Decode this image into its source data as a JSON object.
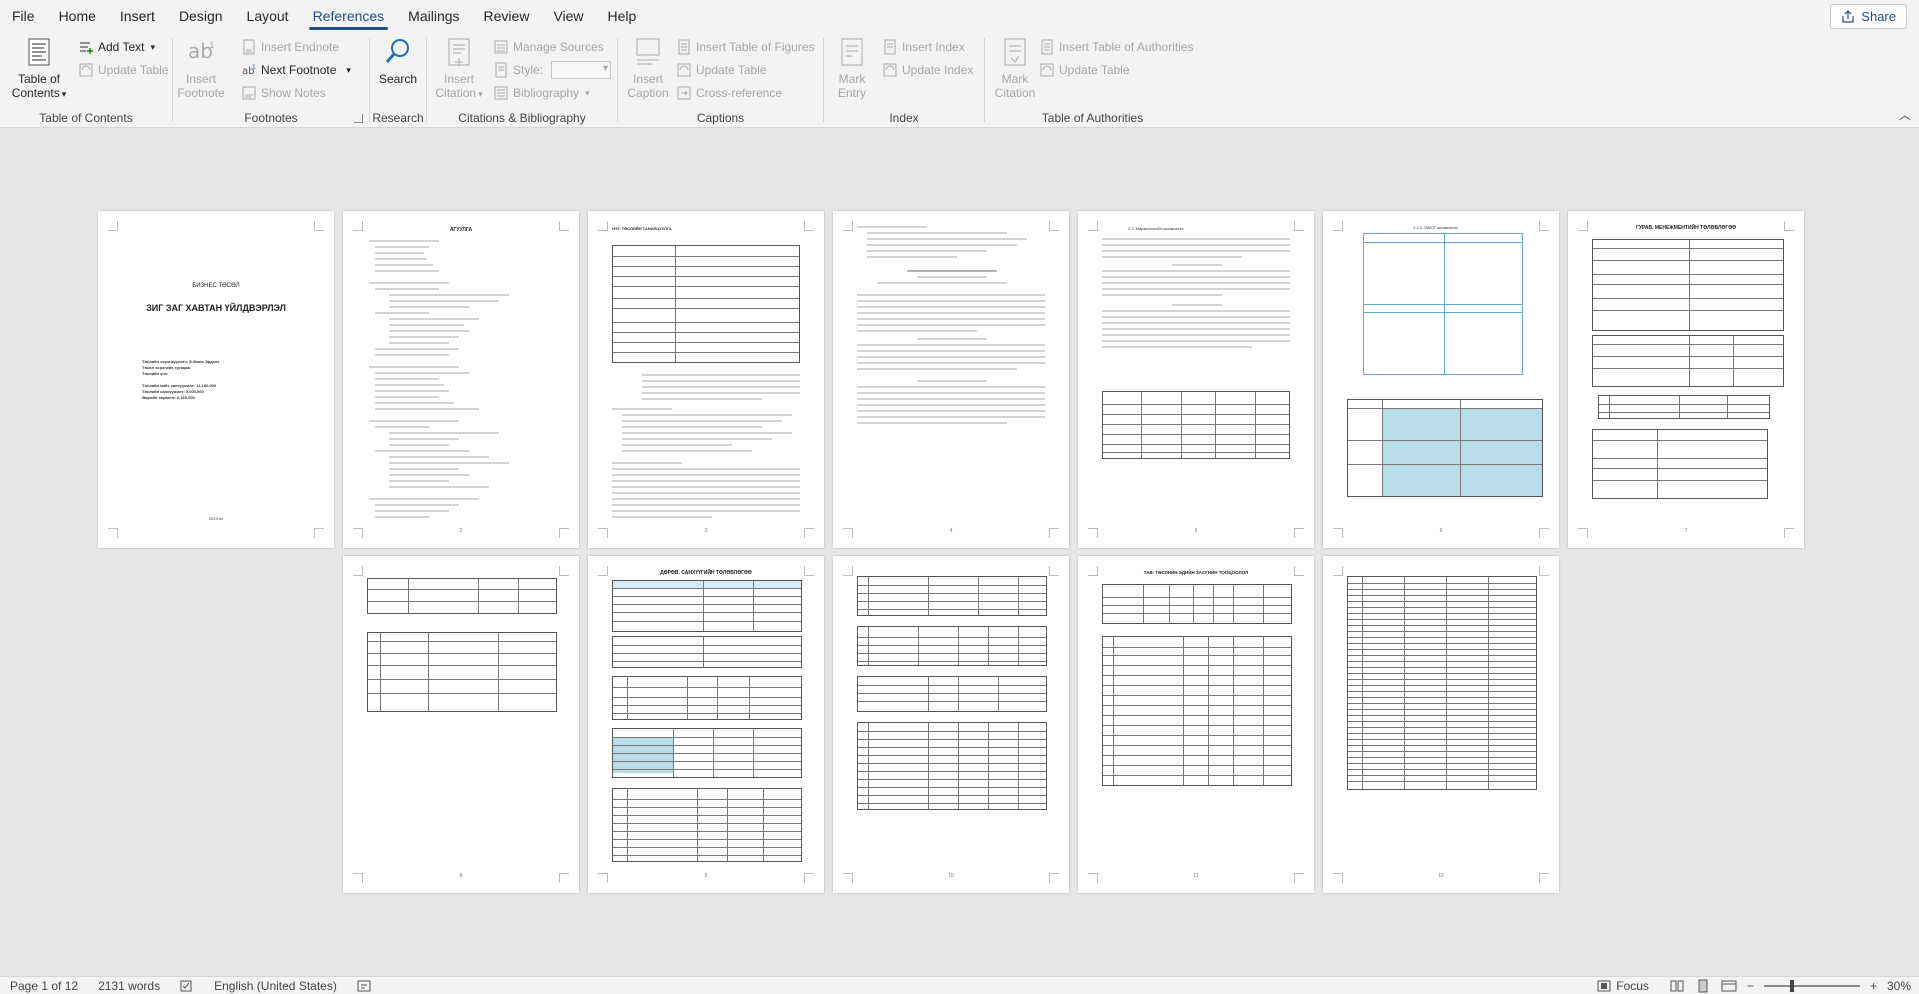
{
  "menu": {
    "tabs": [
      "File",
      "Home",
      "Insert",
      "Design",
      "Layout",
      "References",
      "Mailings",
      "Review",
      "View",
      "Help"
    ],
    "active": "References",
    "share_label": "Share"
  },
  "ribbon": {
    "toc": {
      "btn_line1": "Table of",
      "btn_line2": "Contents",
      "add_text": "Add Text",
      "update_table": "Update Table",
      "label": "Table of Contents"
    },
    "footnotes": {
      "insert_footnote_l1": "Insert",
      "insert_footnote_l2": "Footnote",
      "insert_endnote": "Insert Endnote",
      "next_footnote": "Next Footnote",
      "show_notes": "Show Notes",
      "label": "Footnotes"
    },
    "research": {
      "search": "Search",
      "label": "Research"
    },
    "citations": {
      "insert_citation_l1": "Insert",
      "insert_citation_l2": "Citation",
      "manage_sources": "Manage Sources",
      "style": "Style:",
      "bibliography": "Bibliography",
      "label": "Citations & Bibliography"
    },
    "captions": {
      "insert_caption_l1": "Insert",
      "insert_caption_l2": "Caption",
      "insert_tof": "Insert Table of Figures",
      "update_table": "Update Table",
      "cross_reference": "Cross-reference",
      "label": "Captions"
    },
    "index": {
      "mark_entry_l1": "Mark",
      "mark_entry_l2": "Entry",
      "insert_index": "Insert Index",
      "update_index": "Update Index",
      "label": "Index"
    },
    "toa": {
      "mark_citation_l1": "Mark",
      "mark_citation_l2": "Citation",
      "insert_toa": "Insert Table of Authorities",
      "update_table": "Update Table",
      "label": "Table of Authorities"
    }
  },
  "pages": {
    "p1": {
      "title1": "БИЗНЕС ТӨСӨЛ",
      "title2": "ЗИГ ЗАГ ХАВТАН ҮЙЛДВЭРЛЭЛ",
      "l1": "Төслийн хэрэгжүүлэгч: Б.Мөнх-Эрдэнэ",
      "l2": "Төсөл хэрэгжих хугацаа:",
      "l3": "Төслийн үнэ:",
      "l4": "Төслийн нийт санхүүжилт: 11,160,000",
      "l5": "Төслийн санхүүжилт: 5,000,000",
      "l6": "Өөрийн хөрөнгө: 6,160,000",
      "footer": "2023 он"
    },
    "p2": {
      "title": "АГУУЛГА"
    },
    "p3": {
      "title": "НЭГ. ТӨСЛИЙН ТАНИЛЦУУЛГА"
    },
    "p5": {
      "title": "2.2. Маркетингийн шинжилгээ"
    },
    "p6": {
      "title": "2.2.3. SWOT шинжилгээ"
    },
    "p7": {
      "title": "ГУРАВ. МЕНЕЖМЕНТИЙН ТӨЛӨВЛӨГӨӨ"
    },
    "p9": {
      "title": "ДӨРӨВ. САНХҮҮГИЙН ТӨЛӨВЛӨГӨӨ"
    },
    "p11": {
      "title": "ТАВ. ТӨСЛИЙН ЭДИЙН ЗАСГИЙН ТООЦООЛОЛ"
    },
    "numbers": [
      "1",
      "2",
      "3",
      "4",
      "5",
      "6",
      "7",
      "8",
      "9",
      "10",
      "11",
      "12"
    ]
  },
  "status": {
    "page": "Page 1 of 12",
    "words": "2131 words",
    "language": "English (United States)",
    "focus": "Focus",
    "zoom": "30%"
  }
}
